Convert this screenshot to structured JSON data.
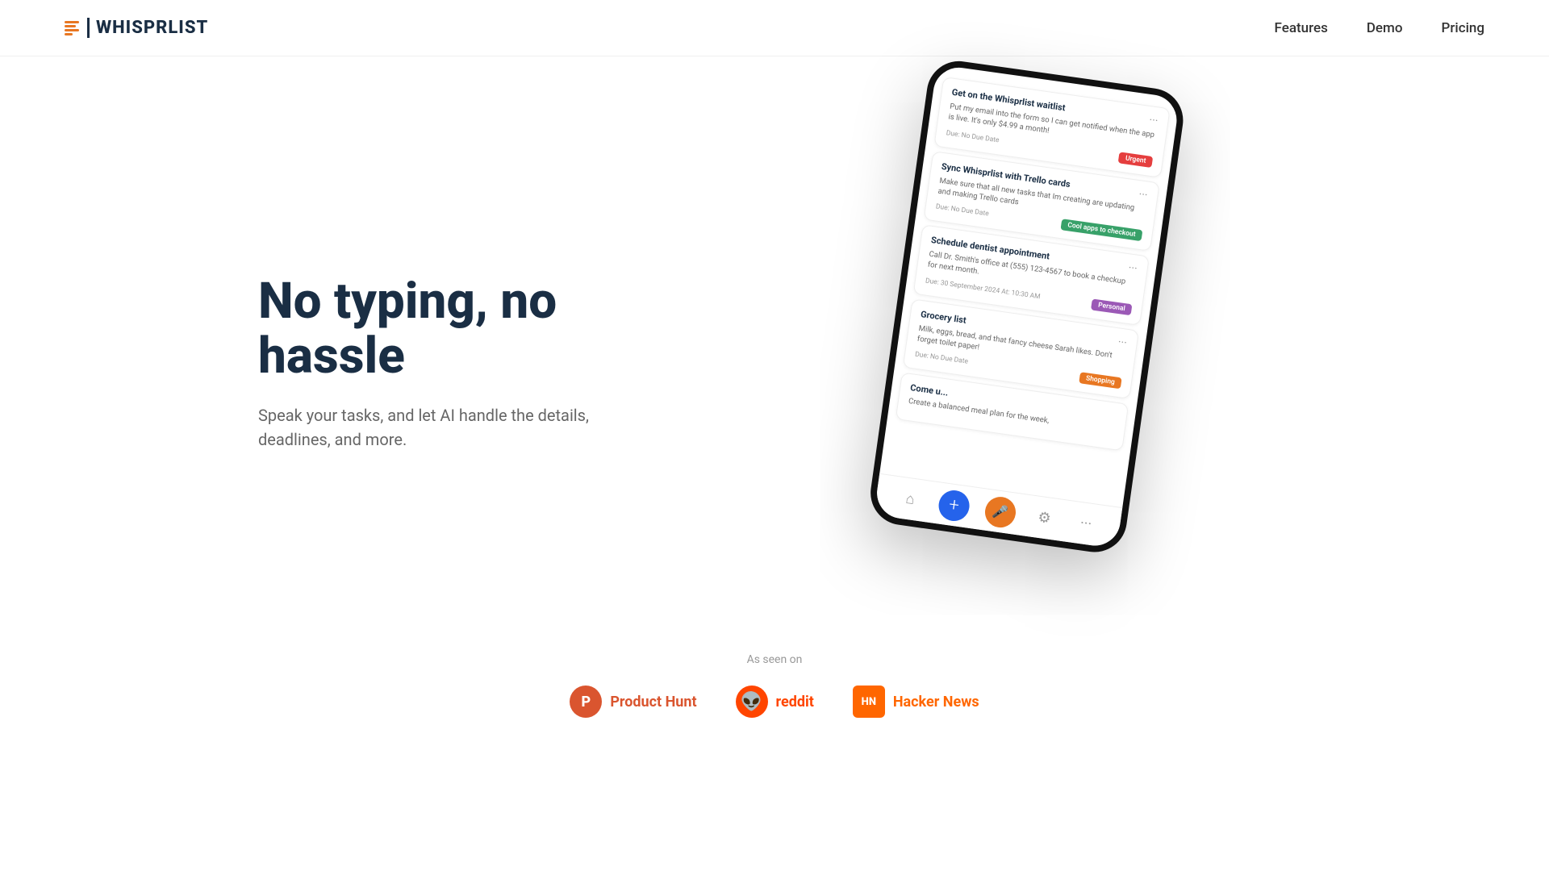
{
  "nav": {
    "logo_text": "WHISPRLIST",
    "links": [
      {
        "label": "Features",
        "href": "#"
      },
      {
        "label": "Demo",
        "href": "#"
      },
      {
        "label": "Pricing",
        "href": "#"
      }
    ]
  },
  "hero": {
    "title": "No typing, no hassle",
    "subtitle": "Speak your tasks, and let AI handle the details, deadlines, and more."
  },
  "phone": {
    "tasks": [
      {
        "title": "Get on the Whisprlist waitlist",
        "desc": "Put my email into the form so I can get notified when the app is live. It's only $4.99 a month!",
        "due": "Due: No Due Date",
        "tag": "Urgent",
        "tag_class": "tag-urgent"
      },
      {
        "title": "Sync Whisprlist with Trello cards",
        "desc": "Make sure that all new tasks that Im creating are updating and making Trello cards",
        "due": "Due: No Due Date",
        "tag": "Cool apps to checkout",
        "tag_class": "tag-cool"
      },
      {
        "title": "Schedule dentist appointment",
        "desc": "Call Dr. Smith's office at (555) 123-4567 to book a checkup for next month.",
        "due": "Due: 30 September 2024 At: 10:30 AM",
        "tag": "Personal",
        "tag_class": "tag-personal"
      },
      {
        "title": "Grocery list",
        "desc": "Milk, eggs, bread, and that fancy cheese Sarah likes. Don't forget toilet paper!",
        "due": "Due: No Due Date",
        "tag": "Shopping",
        "tag_class": "tag-shopping"
      },
      {
        "title": "Come u...",
        "desc": "Create a balanced meal plan for the week,",
        "due": "",
        "tag": "",
        "tag_class": ""
      }
    ]
  },
  "as_seen_on": {
    "label": "As seen on",
    "brands": [
      {
        "name": "Product Hunt",
        "icon_label": "P",
        "icon_class": "ph-icon",
        "name_class": "ph-name"
      },
      {
        "name": "reddit",
        "icon_label": "●",
        "icon_class": "reddit-icon",
        "name_class": "reddit-name"
      },
      {
        "name": "Hacker News",
        "icon_label": "HN",
        "icon_class": "hn-icon",
        "name_class": "hn-name"
      }
    ]
  }
}
